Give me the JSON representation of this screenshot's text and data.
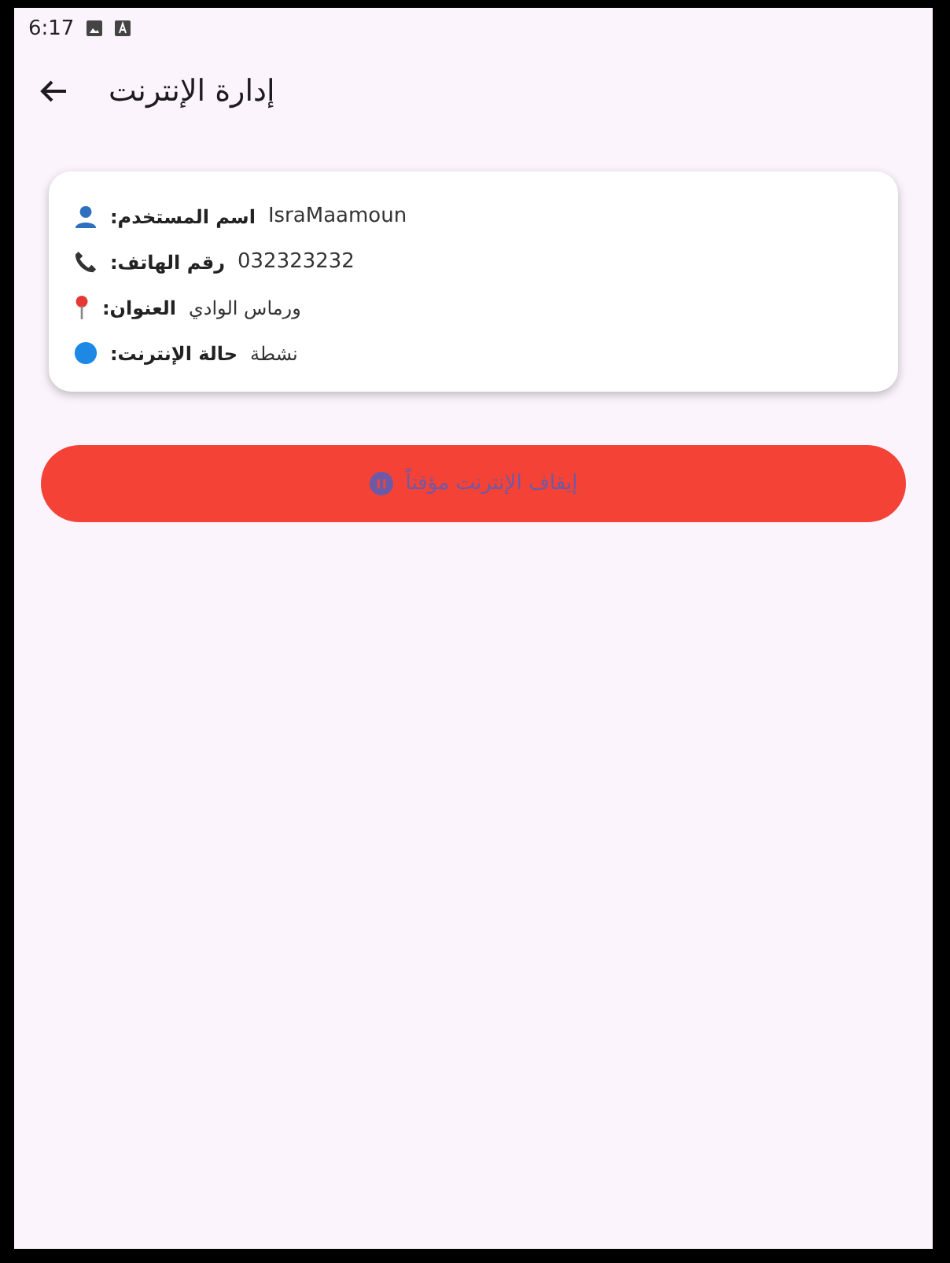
{
  "status_bar": {
    "time": "6:17"
  },
  "app_bar": {
    "title": "إدارة الإنترنت"
  },
  "info_rows": [
    {
      "kind": "user",
      "label": "اسم المستخدم:",
      "value": "IsraMaamoun"
    },
    {
      "kind": "phone",
      "label": "رقم الهاتف:",
      "value": "032323232"
    },
    {
      "kind": "location",
      "label": "العنوان:",
      "value": "ورماس الوادي"
    },
    {
      "kind": "status",
      "label": "حالة الإنترنت:",
      "value": "نشطة"
    }
  ],
  "action_button": {
    "label": "إيقاف الإنترنت مؤقتاً",
    "disabled": true
  }
}
